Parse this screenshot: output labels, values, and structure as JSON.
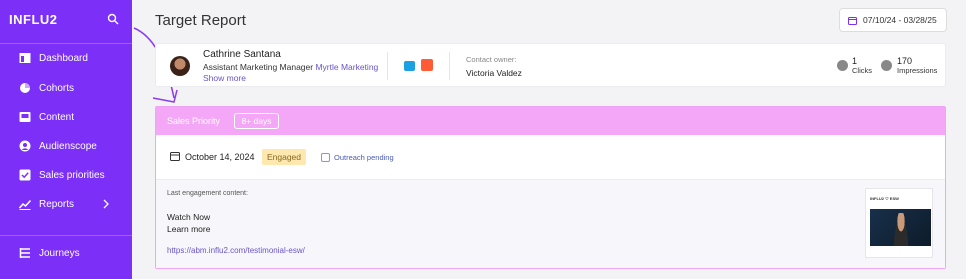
{
  "sidebar": {
    "brand": "INFLU2",
    "items": [
      {
        "label": "Dashboard",
        "icon": "dashboard-icon"
      },
      {
        "label": "Cohorts",
        "icon": "pie-chart-icon"
      },
      {
        "label": "Content",
        "icon": "content-icon"
      },
      {
        "label": "Audienscope",
        "icon": "audience-icon"
      },
      {
        "label": "Sales priorities",
        "icon": "checkbox-icon"
      },
      {
        "label": "Reports",
        "icon": "trend-icon"
      },
      {
        "label": "Journeys",
        "icon": "journeys-icon"
      }
    ]
  },
  "header": {
    "title": "Target Report",
    "date_range": "07/10/24 - 03/28/25"
  },
  "contact": {
    "name": "Cathrine Santana",
    "role": "Assistant Marketing Manager",
    "company": "Myrtle Marketing",
    "show_more": "Show more",
    "owner_label": "Contact owner:",
    "owner_name": "Victoria Valdez",
    "clicks_value": "1",
    "clicks_label": "Clicks",
    "impressions_value": "170",
    "impressions_label": "Impressions"
  },
  "priority": {
    "title": "Sales Priority",
    "badge": "8+ days",
    "date": "October 14, 2024",
    "status": "Engaged",
    "outreach_label": "Outreach pending",
    "last_label": "Last engagement content:",
    "content_line1": "Watch Now",
    "content_line2": "Learn more",
    "link": "https://abm.influ2.com/testimonial-esw/",
    "thumb_header": "INFLU2 ♡ ESW"
  },
  "colors": {
    "sidebar": "#7b2ff7",
    "priority_header": "#f4a7f7",
    "engaged_bg": "#fde8b0"
  }
}
